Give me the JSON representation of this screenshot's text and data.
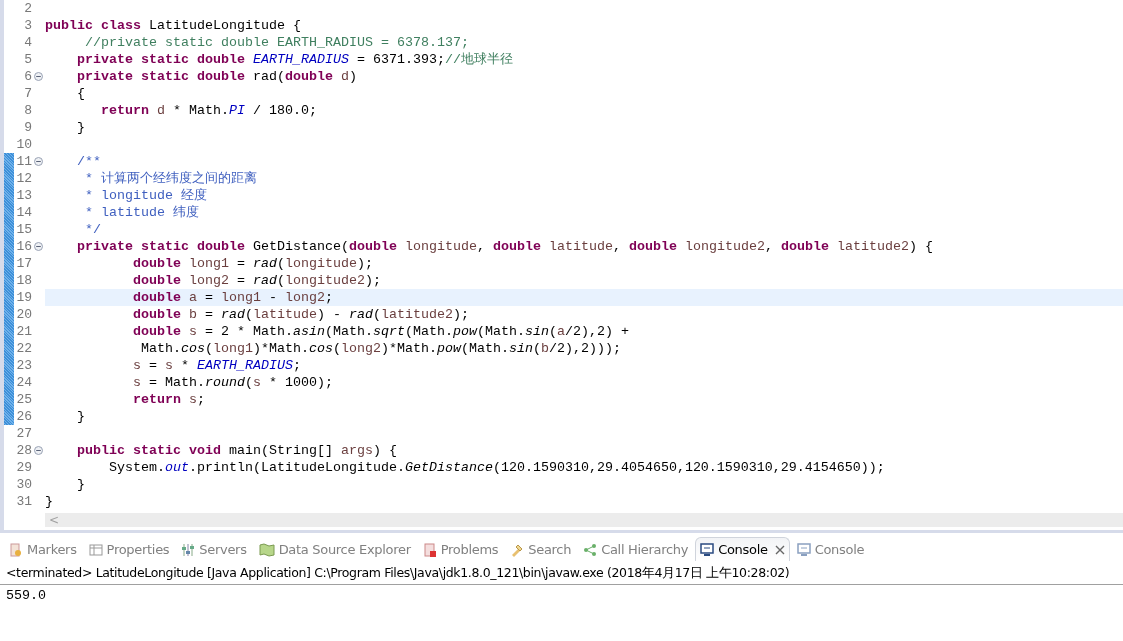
{
  "editor": {
    "lines": [
      {
        "no": "2",
        "fold": false,
        "changed": false,
        "current": false
      },
      {
        "no": "3",
        "fold": false,
        "changed": false,
        "current": false,
        "tokens": [
          {
            "kind": "kw",
            "text": "public class "
          },
          {
            "kind": "p",
            "text": "LatitudeLongitude {"
          }
        ]
      },
      {
        "no": "4",
        "fold": false,
        "changed": false,
        "current": false,
        "tokens": [
          {
            "kind": "comment",
            "text": "     //private static double EARTH_RADIUS = 6378.137;"
          }
        ]
      },
      {
        "no": "5",
        "fold": false,
        "changed": false,
        "current": false,
        "tokens": [
          {
            "kind": "kw",
            "text": "    private static double "
          },
          {
            "kind": "field",
            "text": "EARTH_RADIUS"
          },
          {
            "kind": "p",
            "text": " = 6371.393;"
          },
          {
            "kind": "comment",
            "text": "//地球半径"
          }
        ]
      },
      {
        "no": "6",
        "fold": true,
        "changed": false,
        "current": false,
        "tokens": [
          {
            "kind": "kw",
            "text": "    private static double "
          },
          {
            "kind": "p",
            "text": "rad("
          },
          {
            "kind": "kw",
            "text": "double "
          },
          {
            "kind": "local",
            "text": "d"
          },
          {
            "kind": "p",
            "text": ")"
          }
        ]
      },
      {
        "no": "7",
        "fold": false,
        "changed": false,
        "current": false,
        "tokens": [
          {
            "kind": "p",
            "text": "    {"
          }
        ]
      },
      {
        "no": "8",
        "fold": false,
        "changed": false,
        "current": false,
        "tokens": [
          {
            "kind": "kw",
            "text": "       return "
          },
          {
            "kind": "local",
            "text": "d"
          },
          {
            "kind": "p",
            "text": " * Math."
          },
          {
            "kind": "field",
            "text": "PI"
          },
          {
            "kind": "p",
            "text": " / 180.0;"
          }
        ]
      },
      {
        "no": "9",
        "fold": false,
        "changed": false,
        "current": false,
        "tokens": [
          {
            "kind": "p",
            "text": "    }"
          }
        ]
      },
      {
        "no": "10",
        "fold": false,
        "changed": false,
        "current": false
      },
      {
        "no": "11",
        "fold": true,
        "changed": true,
        "current": false,
        "tokens": [
          {
            "kind": "doc",
            "text": "    /**"
          }
        ]
      },
      {
        "no": "12",
        "fold": false,
        "changed": true,
        "current": false,
        "tokens": [
          {
            "kind": "doc",
            "text": "     * 计算两个经纬度之间的距离"
          }
        ]
      },
      {
        "no": "13",
        "fold": false,
        "changed": true,
        "current": false,
        "tokens": [
          {
            "kind": "doc",
            "text": "     * longitude 经度"
          }
        ]
      },
      {
        "no": "14",
        "fold": false,
        "changed": true,
        "current": false,
        "tokens": [
          {
            "kind": "doc",
            "text": "     * latitude 纬度"
          }
        ]
      },
      {
        "no": "15",
        "fold": false,
        "changed": true,
        "current": false,
        "tokens": [
          {
            "kind": "doc",
            "text": "     */"
          }
        ]
      },
      {
        "no": "16",
        "fold": true,
        "changed": true,
        "current": false,
        "tokens": [
          {
            "kind": "kw",
            "text": "    private static double "
          },
          {
            "kind": "p",
            "text": "GetDistance("
          },
          {
            "kind": "kw",
            "text": "double "
          },
          {
            "kind": "local",
            "text": "longitude"
          },
          {
            "kind": "p",
            "text": ", "
          },
          {
            "kind": "kw",
            "text": "double "
          },
          {
            "kind": "local",
            "text": "latitude"
          },
          {
            "kind": "p",
            "text": ", "
          },
          {
            "kind": "kw",
            "text": "double "
          },
          {
            "kind": "local",
            "text": "longitude2"
          },
          {
            "kind": "p",
            "text": ", "
          },
          {
            "kind": "kw",
            "text": "double "
          },
          {
            "kind": "local",
            "text": "latitude2"
          },
          {
            "kind": "p",
            "text": ") {"
          }
        ]
      },
      {
        "no": "17",
        "fold": false,
        "changed": true,
        "current": false,
        "tokens": [
          {
            "kind": "kw",
            "text": "           double "
          },
          {
            "kind": "local",
            "text": "long1"
          },
          {
            "kind": "p",
            "text": " = "
          },
          {
            "kind": "static",
            "text": "rad"
          },
          {
            "kind": "p",
            "text": "("
          },
          {
            "kind": "local",
            "text": "longitude"
          },
          {
            "kind": "p",
            "text": ");"
          }
        ]
      },
      {
        "no": "18",
        "fold": false,
        "changed": true,
        "current": false,
        "tokens": [
          {
            "kind": "kw",
            "text": "           double "
          },
          {
            "kind": "local",
            "text": "long2"
          },
          {
            "kind": "p",
            "text": " = "
          },
          {
            "kind": "static",
            "text": "rad"
          },
          {
            "kind": "p",
            "text": "("
          },
          {
            "kind": "local",
            "text": "longitude2"
          },
          {
            "kind": "p",
            "text": ");"
          }
        ]
      },
      {
        "no": "19",
        "fold": false,
        "changed": true,
        "current": true,
        "tokens": [
          {
            "kind": "kw",
            "text": "           double "
          },
          {
            "kind": "local",
            "text": "a"
          },
          {
            "kind": "p",
            "text": " = "
          },
          {
            "kind": "local",
            "text": "long1"
          },
          {
            "kind": "p",
            "text": " - "
          },
          {
            "kind": "local",
            "text": "long2"
          },
          {
            "kind": "p",
            "text": ";"
          }
        ]
      },
      {
        "no": "20",
        "fold": false,
        "changed": true,
        "current": false,
        "tokens": [
          {
            "kind": "kw",
            "text": "           double "
          },
          {
            "kind": "local",
            "text": "b"
          },
          {
            "kind": "p",
            "text": " = "
          },
          {
            "kind": "static",
            "text": "rad"
          },
          {
            "kind": "p",
            "text": "("
          },
          {
            "kind": "local",
            "text": "latitude"
          },
          {
            "kind": "p",
            "text": ") - "
          },
          {
            "kind": "static",
            "text": "rad"
          },
          {
            "kind": "p",
            "text": "("
          },
          {
            "kind": "local",
            "text": "latitude2"
          },
          {
            "kind": "p",
            "text": ");"
          }
        ]
      },
      {
        "no": "21",
        "fold": false,
        "changed": true,
        "current": false,
        "tokens": [
          {
            "kind": "kw",
            "text": "           double "
          },
          {
            "kind": "local",
            "text": "s"
          },
          {
            "kind": "p",
            "text": " = 2 * Math."
          },
          {
            "kind": "static",
            "text": "asin"
          },
          {
            "kind": "p",
            "text": "(Math."
          },
          {
            "kind": "static",
            "text": "sqrt"
          },
          {
            "kind": "p",
            "text": "(Math."
          },
          {
            "kind": "static",
            "text": "pow"
          },
          {
            "kind": "p",
            "text": "(Math."
          },
          {
            "kind": "static",
            "text": "sin"
          },
          {
            "kind": "p",
            "text": "("
          },
          {
            "kind": "local",
            "text": "a"
          },
          {
            "kind": "p",
            "text": "/2),2) +"
          }
        ]
      },
      {
        "no": "22",
        "fold": false,
        "changed": true,
        "current": false,
        "tokens": [
          {
            "kind": "p",
            "text": "            Math."
          },
          {
            "kind": "static",
            "text": "cos"
          },
          {
            "kind": "p",
            "text": "("
          },
          {
            "kind": "local",
            "text": "long1"
          },
          {
            "kind": "p",
            "text": ")*Math."
          },
          {
            "kind": "static",
            "text": "cos"
          },
          {
            "kind": "p",
            "text": "("
          },
          {
            "kind": "local",
            "text": "long2"
          },
          {
            "kind": "p",
            "text": ")*Math."
          },
          {
            "kind": "static",
            "text": "pow"
          },
          {
            "kind": "p",
            "text": "(Math."
          },
          {
            "kind": "static",
            "text": "sin"
          },
          {
            "kind": "p",
            "text": "("
          },
          {
            "kind": "local",
            "text": "b"
          },
          {
            "kind": "p",
            "text": "/2),2)));"
          }
        ]
      },
      {
        "no": "23",
        "fold": false,
        "changed": true,
        "current": false,
        "tokens": [
          {
            "kind": "local",
            "text": "           s"
          },
          {
            "kind": "p",
            "text": " = "
          },
          {
            "kind": "local",
            "text": "s"
          },
          {
            "kind": "p",
            "text": " * "
          },
          {
            "kind": "field",
            "text": "EARTH_RADIUS"
          },
          {
            "kind": "p",
            "text": ";"
          }
        ]
      },
      {
        "no": "24",
        "fold": false,
        "changed": true,
        "current": false,
        "tokens": [
          {
            "kind": "local",
            "text": "           s"
          },
          {
            "kind": "p",
            "text": " = Math."
          },
          {
            "kind": "static",
            "text": "round"
          },
          {
            "kind": "p",
            "text": "("
          },
          {
            "kind": "local",
            "text": "s"
          },
          {
            "kind": "p",
            "text": " * 1000);"
          }
        ]
      },
      {
        "no": "25",
        "fold": false,
        "changed": true,
        "current": false,
        "tokens": [
          {
            "kind": "kw",
            "text": "           return "
          },
          {
            "kind": "local",
            "text": "s"
          },
          {
            "kind": "p",
            "text": ";"
          }
        ]
      },
      {
        "no": "26",
        "fold": false,
        "changed": true,
        "current": false,
        "tokens": [
          {
            "kind": "p",
            "text": "    }"
          }
        ]
      },
      {
        "no": "27",
        "fold": false,
        "changed": false,
        "current": false
      },
      {
        "no": "28",
        "fold": true,
        "changed": false,
        "current": false,
        "tokens": [
          {
            "kind": "kw",
            "text": "    public static void "
          },
          {
            "kind": "p",
            "text": "main(String[] "
          },
          {
            "kind": "local",
            "text": "args"
          },
          {
            "kind": "p",
            "text": ") {"
          }
        ]
      },
      {
        "no": "29",
        "fold": false,
        "changed": false,
        "current": false,
        "tokens": [
          {
            "kind": "p",
            "text": "        System."
          },
          {
            "kind": "field",
            "text": "out"
          },
          {
            "kind": "p",
            "text": ".println(LatitudeLongitude."
          },
          {
            "kind": "static",
            "text": "GetDistance"
          },
          {
            "kind": "p",
            "text": "(120.1590310,29.4054650,120.1590310,29.4154650));"
          }
        ]
      },
      {
        "no": "30",
        "fold": false,
        "changed": false,
        "current": false,
        "tokens": [
          {
            "kind": "p",
            "text": "    }"
          }
        ]
      },
      {
        "no": "31",
        "fold": false,
        "changed": false,
        "current": false,
        "tokens": [
          {
            "kind": "p",
            "text": "}"
          }
        ]
      }
    ],
    "scroll_left": "<"
  },
  "panel": {
    "tabs": [
      {
        "label": "Markers",
        "selected": false
      },
      {
        "label": "Properties",
        "selected": false
      },
      {
        "label": "Servers",
        "selected": false
      },
      {
        "label": "Data Source Explorer",
        "selected": false
      },
      {
        "label": "Problems",
        "selected": false
      },
      {
        "label": "Search",
        "selected": false
      },
      {
        "label": "Call Hierarchy",
        "selected": false
      },
      {
        "label": "Console",
        "selected": true
      },
      {
        "label": "Console",
        "selected": false
      }
    ],
    "header": "<terminated> LatitudeLongitude [Java Application] C:\\Program Files\\Java\\jdk1.8.0_121\\bin\\javaw.exe (2018年4月17日 上午10:28:02)",
    "output": "559.0"
  }
}
